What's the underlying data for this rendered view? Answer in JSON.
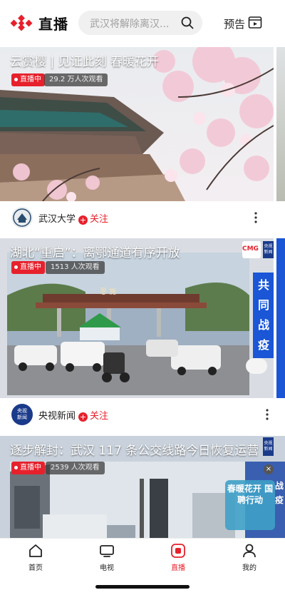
{
  "header": {
    "title": "直播",
    "search_placeholder": "武汉将解除离汉...",
    "preview_label": "预告"
  },
  "cards": [
    {
      "title": "云赏樱 | 见证此刻 春暖花开",
      "live_label": "直播中",
      "viewers": "29.2 万人次观看",
      "channel": "武汉大学",
      "follow_label": "关注"
    },
    {
      "title": "湖北“重启”：离鄂通道有序开放",
      "live_label": "直播中",
      "viewers": "1513 人次观看",
      "channel": "央视新闻",
      "follow_label": "关注",
      "badge_top": "央视\n新闻",
      "side_banner": "共同战疫",
      "toll_sign": "恩 施"
    },
    {
      "title": "逐步解封：武汉 117 条公交线路今日恢复运营",
      "live_label": "直播中",
      "viewers": "2539 人次观看",
      "side_banner": "战疫",
      "overlay_text": "春暖花开 国聘行动"
    }
  ],
  "tabbar": {
    "items": [
      {
        "label": "首页",
        "icon": "home-icon"
      },
      {
        "label": "电视",
        "icon": "tv-icon"
      },
      {
        "label": "直播",
        "icon": "live-icon",
        "active": true
      },
      {
        "label": "我的",
        "icon": "profile-icon"
      }
    ]
  },
  "colors": {
    "accent": "#e6212c",
    "brand_blue": "#1a56d6"
  }
}
